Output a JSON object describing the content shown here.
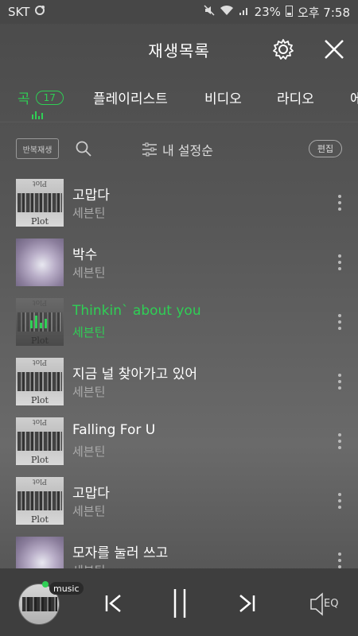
{
  "status_bar": {
    "carrier": "SKT",
    "battery": "23%",
    "time": "오후 7:58"
  },
  "header": {
    "title": "재생목록"
  },
  "tabs": [
    {
      "label": "곡",
      "count": "17",
      "active": true
    },
    {
      "label": "플레이리스트"
    },
    {
      "label": "비디오"
    },
    {
      "label": "라디오"
    },
    {
      "label": "에"
    }
  ],
  "toolbar": {
    "repeat_label": "반복재생",
    "sort_label": "내 설정순",
    "edit_label": "편집"
  },
  "tracks": [
    {
      "title": "고맙다",
      "artist": "세븐틴",
      "playing": false
    },
    {
      "title": "박수",
      "artist": "세븐틴",
      "playing": false
    },
    {
      "title": "Thinkin` about you",
      "artist": "세븐틴",
      "playing": true
    },
    {
      "title": "지금 널 찾아가고 있어",
      "artist": "세븐틴",
      "playing": false
    },
    {
      "title": "Falling For U",
      "artist": "세븐틴",
      "playing": false
    },
    {
      "title": "고맙다",
      "artist": "세븐틴",
      "playing": false
    },
    {
      "title": "모자를 눌러 쓰고",
      "artist": "세븐틴",
      "playing": false
    }
  ],
  "album_art": {
    "top_text": "Plot",
    "bottom_text": "Plot"
  },
  "player": {
    "badge": "music",
    "eq_label": "EQ"
  },
  "colors": {
    "accent": "#2fcf55",
    "background": "#575757",
    "player_bar": "#3e3e3e"
  }
}
